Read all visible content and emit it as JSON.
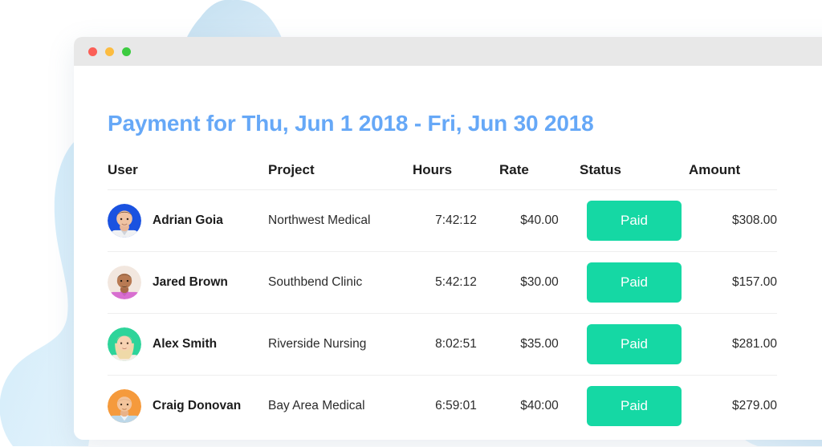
{
  "window": {
    "traffic_lights": [
      {
        "name": "close",
        "color": "#fb5f57"
      },
      {
        "name": "minimize",
        "color": "#fcbc40"
      },
      {
        "name": "maximize",
        "color": "#3ccb40"
      }
    ]
  },
  "page": {
    "title": "Payment for Thu, Jun 1 2018 - Fri, Jun 30 2018",
    "title_color": "#66a8f7"
  },
  "table": {
    "headers": {
      "user": "User",
      "project": "Project",
      "hours": "Hours",
      "rate": "Rate",
      "status": "Status",
      "amount": "Amount"
    },
    "rows": [
      {
        "user": "Adrian Goia",
        "project": "Northwest Medical",
        "hours": "7:42:12",
        "rate": "$40.00",
        "status": "Paid",
        "amount": "$308.00",
        "avatar": "avatar-adrian-goia"
      },
      {
        "user": "Jared Brown",
        "project": "Southbend Clinic",
        "hours": "5:42:12",
        "rate": "$30.00",
        "status": "Paid",
        "amount": "$157.00",
        "avatar": "avatar-jared-brown"
      },
      {
        "user": "Alex Smith",
        "project": "Riverside Nursing",
        "hours": "8:02:51",
        "rate": "$35.00",
        "status": "Paid",
        "amount": "$281.00",
        "avatar": "avatar-alex-smith"
      },
      {
        "user": "Craig Donovan",
        "project": "Bay Area Medical",
        "hours": "6:59:01",
        "rate": "$40:00",
        "status": "Paid",
        "amount": "$279.00",
        "avatar": "avatar-craig-donovan"
      }
    ]
  },
  "colors": {
    "status_paid": "#15d8a4",
    "title_blue": "#66a8f7",
    "blob_blue": "#cfe8f8",
    "titlebar_gray": "#e8e8e8"
  }
}
